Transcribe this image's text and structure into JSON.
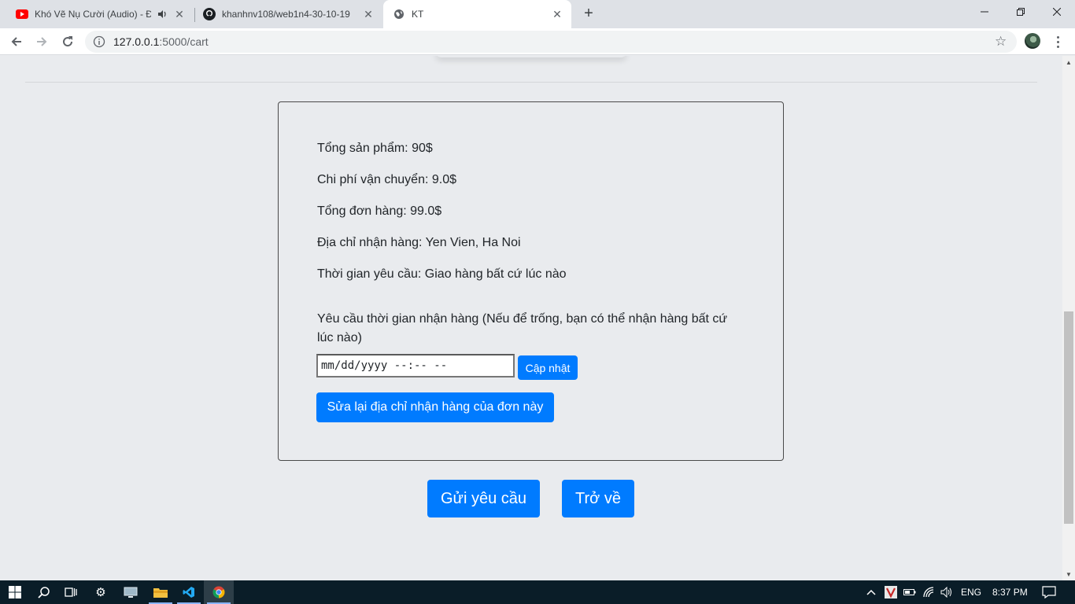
{
  "browser": {
    "tabs": [
      {
        "title": "Khó Vẽ Nụ Cười (Audio) - Đạ",
        "icon": "youtube-icon",
        "audio": true,
        "active": false
      },
      {
        "title": "khanhnv108/web1n4-30-10-19",
        "icon": "github-icon",
        "active": false
      },
      {
        "title": "KT",
        "icon": "globe-icon",
        "active": true
      }
    ],
    "url_host": "127.0.0.1",
    "url_path": ":5000/cart"
  },
  "summary": {
    "products_total": "Tổng sản phẩm: 90$",
    "shipping_cost": "Chi phí vận chuyển: 9.0$",
    "order_total": "Tổng đơn hàng: 99.0$",
    "address": "Địa chỉ nhận hàng: Yen Vien, Ha Noi",
    "requested_time": "Thời gian yêu cầu: Giao hàng bất cứ lúc nào"
  },
  "delivery_request": {
    "label": "Yêu cầu thời gian nhận hàng (Nếu để trống, bạn có thể nhận hàng bất cứ lúc nào)",
    "datetime_placeholder": "mm/dd/yyyy --:-- --",
    "update_label": "Cập nhật",
    "edit_address_label": "Sửa lại địa chỉ nhận hàng của đơn này"
  },
  "actions": {
    "send_label": "Gửi yêu cầu",
    "back_label": "Trở về"
  },
  "taskbar": {
    "language": "ENG",
    "time": "8:37 PM"
  },
  "colors": {
    "primary": "#007bff",
    "page_bg": "#e9ebee",
    "taskbar_bg": "#0a1d28"
  }
}
